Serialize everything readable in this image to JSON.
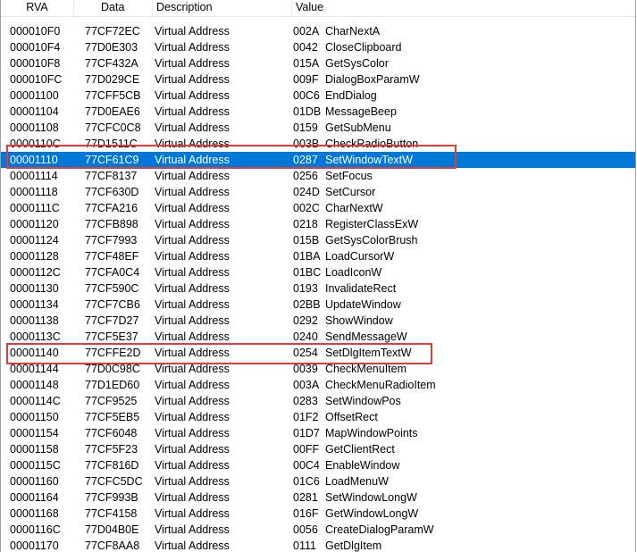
{
  "headers": {
    "rva": "RVA",
    "data": "Data",
    "description": "Description",
    "value": "Value"
  },
  "rows": [
    {
      "rva": "000010F0",
      "data": "77CF72EC",
      "description": "Virtual Address",
      "code": "002A",
      "name": "CharNextA"
    },
    {
      "rva": "000010F4",
      "data": "77D0E303",
      "description": "Virtual Address",
      "code": "0042",
      "name": "CloseClipboard"
    },
    {
      "rva": "000010F8",
      "data": "77CF432A",
      "description": "Virtual Address",
      "code": "015A",
      "name": "GetSysColor"
    },
    {
      "rva": "000010FC",
      "data": "77D029CE",
      "description": "Virtual Address",
      "code": "009F",
      "name": "DialogBoxParamW"
    },
    {
      "rva": "00001100",
      "data": "77CFF5CB",
      "description": "Virtual Address",
      "code": "00C6",
      "name": "EndDialog"
    },
    {
      "rva": "00001104",
      "data": "77D0EAE6",
      "description": "Virtual Address",
      "code": "01DB",
      "name": "MessageBeep"
    },
    {
      "rva": "00001108",
      "data": "77CFC0C8",
      "description": "Virtual Address",
      "code": "0159",
      "name": "GetSubMenu"
    },
    {
      "rva": "0000110C",
      "data": "77D1511C",
      "description": "Virtual Address",
      "code": "003B",
      "name": "CheckRadioButton"
    },
    {
      "rva": "00001110",
      "data": "77CF61C9",
      "description": "Virtual Address",
      "code": "0287",
      "name": "SetWindowTextW"
    },
    {
      "rva": "00001114",
      "data": "77CF8137",
      "description": "Virtual Address",
      "code": "0256",
      "name": "SetFocus"
    },
    {
      "rva": "00001118",
      "data": "77CF630D",
      "description": "Virtual Address",
      "code": "024D",
      "name": "SetCursor"
    },
    {
      "rva": "0000111C",
      "data": "77CFA216",
      "description": "Virtual Address",
      "code": "002C",
      "name": "CharNextW"
    },
    {
      "rva": "00001120",
      "data": "77CFB898",
      "description": "Virtual Address",
      "code": "0218",
      "name": "RegisterClassExW"
    },
    {
      "rva": "00001124",
      "data": "77CF7993",
      "description": "Virtual Address",
      "code": "015B",
      "name": "GetSysColorBrush"
    },
    {
      "rva": "00001128",
      "data": "77CF48EF",
      "description": "Virtual Address",
      "code": "01BA",
      "name": "LoadCursorW"
    },
    {
      "rva": "0000112C",
      "data": "77CFA0C4",
      "description": "Virtual Address",
      "code": "01BC",
      "name": "LoadIconW"
    },
    {
      "rva": "00001130",
      "data": "77CF590C",
      "description": "Virtual Address",
      "code": "0193",
      "name": "InvalidateRect"
    },
    {
      "rva": "00001134",
      "data": "77CF7CB6",
      "description": "Virtual Address",
      "code": "02BB",
      "name": "UpdateWindow"
    },
    {
      "rva": "00001138",
      "data": "77CF7D27",
      "description": "Virtual Address",
      "code": "0292",
      "name": "ShowWindow"
    },
    {
      "rva": "0000113C",
      "data": "77CF5E37",
      "description": "Virtual Address",
      "code": "0240",
      "name": "SendMessageW"
    },
    {
      "rva": "00001140",
      "data": "77CFFE2D",
      "description": "Virtual Address",
      "code": "0254",
      "name": "SetDlgItemTextW"
    },
    {
      "rva": "00001144",
      "data": "77D0C98C",
      "description": "Virtual Address",
      "code": "0039",
      "name": "CheckMenuItem"
    },
    {
      "rva": "00001148",
      "data": "77D1ED60",
      "description": "Virtual Address",
      "code": "003A",
      "name": "CheckMenuRadioItem"
    },
    {
      "rva": "0000114C",
      "data": "77CF9525",
      "description": "Virtual Address",
      "code": "0283",
      "name": "SetWindowPos"
    },
    {
      "rva": "00001150",
      "data": "77CF5EB5",
      "description": "Virtual Address",
      "code": "01F2",
      "name": "OffsetRect"
    },
    {
      "rva": "00001154",
      "data": "77CF6048",
      "description": "Virtual Address",
      "code": "01D7",
      "name": "MapWindowPoints"
    },
    {
      "rva": "00001158",
      "data": "77CF5F23",
      "description": "Virtual Address",
      "code": "00FF",
      "name": "GetClientRect"
    },
    {
      "rva": "0000115C",
      "data": "77CF816D",
      "description": "Virtual Address",
      "code": "00C4",
      "name": "EnableWindow"
    },
    {
      "rva": "00001160",
      "data": "77CFC5DC",
      "description": "Virtual Address",
      "code": "01C6",
      "name": "LoadMenuW"
    },
    {
      "rva": "00001164",
      "data": "77CF993B",
      "description": "Virtual Address",
      "code": "0281",
      "name": "SetWindowLongW"
    },
    {
      "rva": "00001168",
      "data": "77CF4158",
      "description": "Virtual Address",
      "code": "016F",
      "name": "GetWindowLongW"
    },
    {
      "rva": "0000116C",
      "data": "77D04B0E",
      "description": "Virtual Address",
      "code": "0056",
      "name": "CreateDialogParamW"
    },
    {
      "rva": "00001170",
      "data": "77CF8AA8",
      "description": "Virtual Address",
      "code": "0111",
      "name": "GetDlgItem"
    }
  ],
  "selected_row_index": 8,
  "highlighted_row_indices": [
    8,
    20
  ],
  "colors": {
    "selection": "#0078d7",
    "highlight_box": "#e03c3c"
  }
}
